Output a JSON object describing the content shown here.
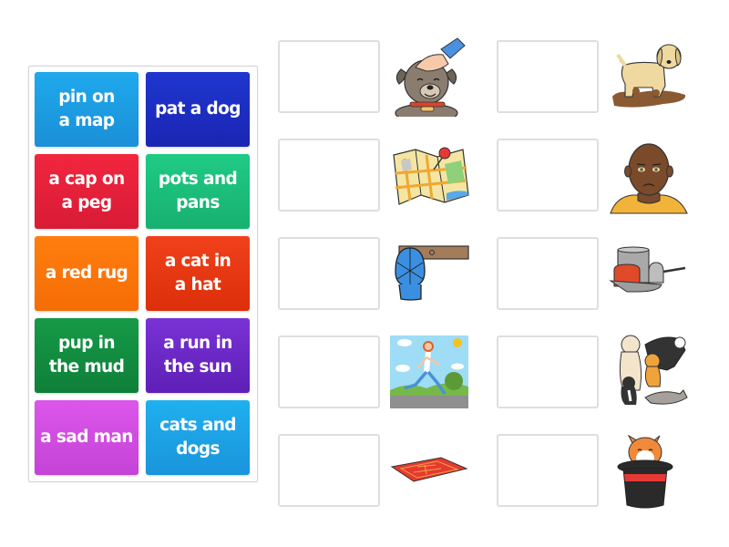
{
  "activity": {
    "type": "match-up",
    "tiles": [
      {
        "label": "pin on\na map",
        "color_top": "#1fa9ec",
        "color_bottom": "#1b8fd8"
      },
      {
        "label": "pat a dog",
        "color_top": "#1f36cf",
        "color_bottom": "#1a26b3"
      },
      {
        "label": "a cap on\na peg",
        "color_top": "#f2263f",
        "color_bottom": "#d81b35"
      },
      {
        "label": "pots and\npans",
        "color_top": "#1fcb85",
        "color_bottom": "#18b070"
      },
      {
        "label": "a red rug",
        "color_top": "#ff7e0f",
        "color_bottom": "#f56d05"
      },
      {
        "label": "a cat in\na hat",
        "color_top": "#f0411b",
        "color_bottom": "#dc2f0a"
      },
      {
        "label": "pup in\nthe mud",
        "color_top": "#169a47",
        "color_bottom": "#0f7f39"
      },
      {
        "label": "a run in\nthe sun",
        "color_top": "#7a32d6",
        "color_bottom": "#5e1fb6"
      },
      {
        "label": "a sad man",
        "color_top": "#dc56ea",
        "color_bottom": "#c443d6"
      },
      {
        "label": "cats and\ndogs",
        "color_top": "#1fb0ee",
        "color_bottom": "#1a94dc"
      }
    ],
    "targets": [
      {
        "image": "hand-patting-dog",
        "answer_slot": ""
      },
      {
        "image": "map-with-pin",
        "answer_slot": ""
      },
      {
        "image": "blue-cap-on-peg",
        "answer_slot": ""
      },
      {
        "image": "girl-running-in-sun",
        "answer_slot": ""
      },
      {
        "image": "red-rug",
        "answer_slot": ""
      },
      {
        "image": "puppy-in-mud",
        "answer_slot": ""
      },
      {
        "image": "sad-boy-face",
        "answer_slot": ""
      },
      {
        "image": "pots-and-pans",
        "answer_slot": ""
      },
      {
        "image": "cats-and-dogs-group",
        "answer_slot": ""
      },
      {
        "image": "cat-in-top-hat",
        "answer_slot": ""
      }
    ]
  }
}
